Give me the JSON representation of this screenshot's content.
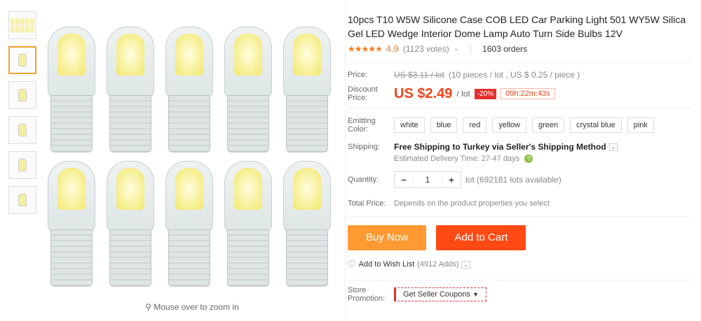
{
  "thumbnails": [
    {
      "name": "thumb-multi"
    },
    {
      "name": "thumb-2"
    },
    {
      "name": "thumb-3"
    },
    {
      "name": "thumb-4"
    },
    {
      "name": "thumb-5"
    },
    {
      "name": "thumb-6"
    }
  ],
  "main_image": {
    "zoom_hint": "Mouse over to zoom in",
    "bulbs": [
      "bulb",
      "bulb",
      "bulb",
      "bulb",
      "bulb",
      "bulb",
      "bulb",
      "bulb",
      "bulb",
      "bulb"
    ]
  },
  "product": {
    "title": "10pcs T10 W5W Silicone Case COB LED Car Parking Light 501 WY5W Silica Gel LED Wedge Interior Dome Lamp Auto Turn Side Bulbs 12V",
    "stars": "★★★★★",
    "rating": "4.9",
    "votes": "(1123 votes)",
    "orders": "1603 orders"
  },
  "price": {
    "label": "Price:",
    "old_price": "US $3.11 / lot",
    "per_piece_note": "(10 pieces / lot , US $ 0.25 / piece )",
    "discount_label": "Discount Price:",
    "discount_price": "US $2.49",
    "per_lot": "/ lot",
    "discount_badge": "-20%",
    "timer": "09h:22m:43s"
  },
  "color": {
    "label": "Emitting Color:",
    "options": [
      "white",
      "blue",
      "red",
      "yellow",
      "green",
      "crystal blue",
      "pink"
    ]
  },
  "shipping": {
    "label": "Shipping:",
    "text": "Free Shipping to Turkey via Seller's Shipping Method",
    "delivery": "Estimated Delivery Time: 27-47 days"
  },
  "quantity": {
    "label": "Quantity:",
    "value": "1",
    "minus": "−",
    "plus": "+",
    "availability": "lot (692181 lots available)"
  },
  "total": {
    "label": "Total Price:",
    "note": "Depends on the product properties you select"
  },
  "actions": {
    "buy_now": "Buy Now",
    "add_to_cart": "Add to Cart",
    "wish_list": "Add to Wish List",
    "wish_count": "(4912 Adds)"
  },
  "store": {
    "label": "Store Promotion:",
    "coupons": "Get Seller Coupons"
  },
  "colors": {
    "accent": "#ff4a14",
    "buy": "#ff9a33",
    "rating": "#f27a1a"
  }
}
